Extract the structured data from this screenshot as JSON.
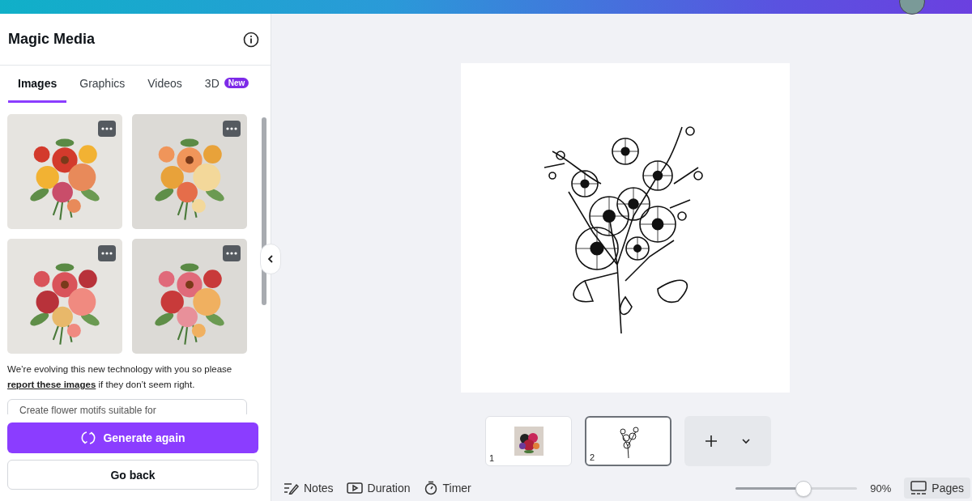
{
  "panel": {
    "title": "Magic Media",
    "tabs": [
      {
        "label": "Images",
        "selected": true
      },
      {
        "label": "Graphics",
        "selected": false
      },
      {
        "label": "Videos",
        "selected": false
      },
      {
        "label": "3D",
        "selected": false,
        "badge": "New"
      }
    ],
    "notice_before": "We’re evolving this new technology with you so please ",
    "notice_link": "report these images",
    "notice_after": " if they don’t seem right.",
    "prompt": "Create flower motifs suitable for",
    "generate_button": "Generate again",
    "back_button": "Go back"
  },
  "pages": [
    {
      "number": "1",
      "kind": "picture",
      "selected": false
    },
    {
      "number": "2",
      "kind": "drawing",
      "selected": true
    }
  ],
  "footer": {
    "tools": [
      {
        "label": "Notes",
        "kind": "notes"
      },
      {
        "label": "Duration",
        "kind": "duration"
      },
      {
        "label": "Timer",
        "kind": "timer"
      }
    ],
    "zoom": {
      "level": 0.55,
      "reading": "90%"
    },
    "pages_button": "Pages"
  }
}
